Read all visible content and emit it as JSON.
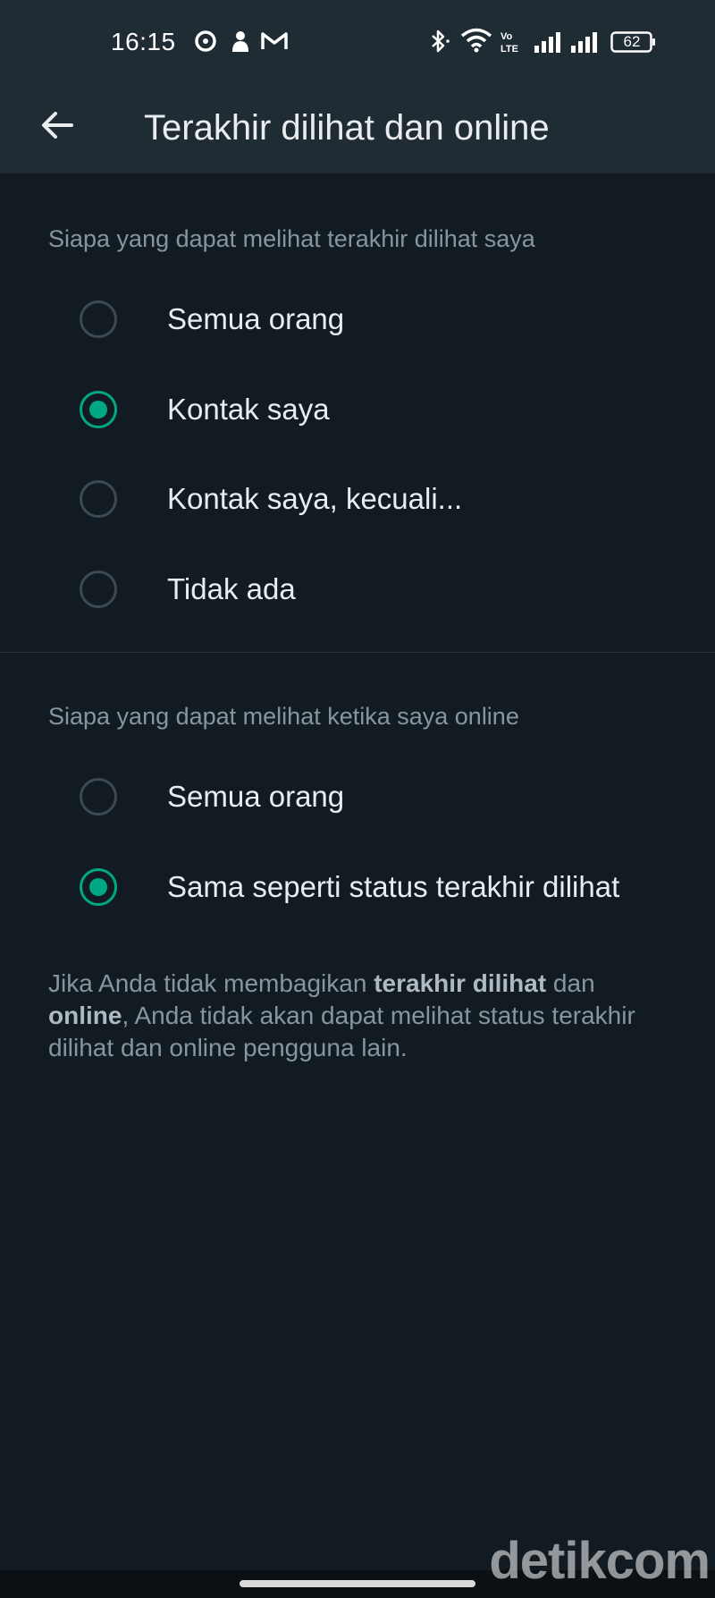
{
  "status_bar": {
    "time": "16:15",
    "left_icons": [
      "gps-icon",
      "notification-icon",
      "gmail-icon"
    ],
    "right_icons": [
      "bluetooth-icon",
      "wifi-icon",
      "volte-icon",
      "signal-icon",
      "signal-icon-2",
      "battery-icon"
    ],
    "battery_level": "62"
  },
  "app_bar": {
    "back_icon": "arrow-left-icon",
    "title": "Terakhir dilihat dan online"
  },
  "sections": [
    {
      "header": "Siapa yang dapat melihat terakhir dilihat saya",
      "options": [
        {
          "label": "Semua orang",
          "checked": false
        },
        {
          "label": "Kontak saya",
          "checked": true
        },
        {
          "label": "Kontak saya, kecuali...",
          "checked": false
        },
        {
          "label": "Tidak ada",
          "checked": false
        }
      ]
    },
    {
      "header": "Siapa yang dapat melihat ketika saya online",
      "options": [
        {
          "label": "Semua orang",
          "checked": false
        },
        {
          "label": "Sama seperti status terakhir dilihat",
          "checked": true
        }
      ]
    }
  ],
  "note": {
    "part1": "Jika Anda tidak membagikan ",
    "bold1": "terakhir dilihat",
    "part2": " dan ",
    "bold2": "online",
    "part3": ", Anda tidak akan dapat melihat status terakhir dilihat dan online pengguna lain."
  },
  "watermark": "detikcom",
  "colors": {
    "background": "#121b22",
    "app_bar": "#202c33",
    "accent": "#00a884",
    "secondary_text": "#8696a0",
    "primary_text": "#e9edef"
  }
}
